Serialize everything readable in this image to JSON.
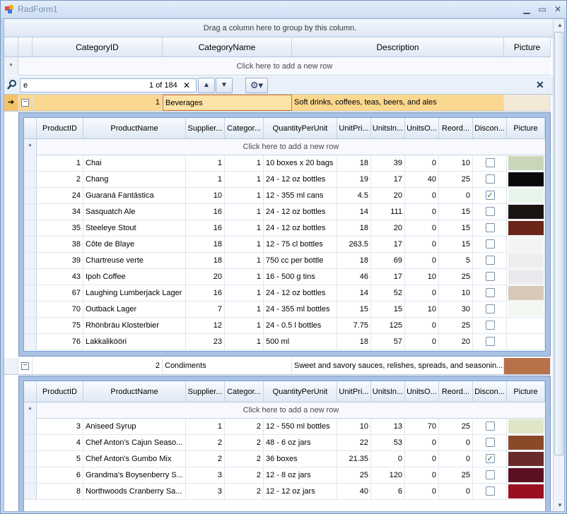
{
  "window": {
    "title": "RadForm1",
    "minimize": "▁",
    "maximize": "▭",
    "close": "✕"
  },
  "group_panel": {
    "text": "Drag a column here to group by this column."
  },
  "master_columns": [
    "CategoryID",
    "CategoryName",
    "Description",
    "Picture"
  ],
  "new_row_text": "Click here to add a new row",
  "new_row_marker": "*",
  "search": {
    "value": "e",
    "counter": "1 of 184",
    "clear": "✕",
    "close": "✕"
  },
  "master_rows": [
    {
      "id": "1",
      "name": "Beverages",
      "description": "Soft drinks, coffees, teas, beers, and ales",
      "pictureColor": "#f3e9d6"
    },
    {
      "id": "2",
      "name": "Condiments",
      "description": "Sweet and savory sauces, relishes, spreads, and seasonin...",
      "pictureColor": "#b9714a"
    }
  ],
  "child_columns": [
    "ProductID",
    "ProductName",
    "Supplier...",
    "Categor...",
    "QuantityPerUnit",
    "UnitPri...",
    "UnitsIn...",
    "UnitsO...",
    "Reord...",
    "Discon...",
    "Picture"
  ],
  "child_rows_1": [
    {
      "id": "1",
      "name": "Chai",
      "sup": "1",
      "cat": "1",
      "qty": "10 boxes x 20 bags",
      "price": "18",
      "stock": "39",
      "order": "0",
      "reorder": "10",
      "disc": false,
      "pic": "#c9d6b8"
    },
    {
      "id": "2",
      "name": "Chang",
      "sup": "1",
      "cat": "1",
      "qty": "24 - 12 oz bottles",
      "price": "19",
      "stock": "17",
      "order": "40",
      "reorder": "25",
      "disc": false,
      "pic": "#0a0a0a"
    },
    {
      "id": "24",
      "name": "Guaraná Fantástica",
      "sup": "10",
      "cat": "1",
      "qty": "12 - 355 ml cans",
      "price": "4.5",
      "stock": "20",
      "order": "0",
      "reorder": "0",
      "disc": true,
      "pic": "#e8f5ea"
    },
    {
      "id": "34",
      "name": "Sasquatch Ale",
      "sup": "16",
      "cat": "1",
      "qty": "24 - 12 oz bottles",
      "price": "14",
      "stock": "111",
      "order": "0",
      "reorder": "15",
      "disc": false,
      "pic": "#1a1512"
    },
    {
      "id": "35",
      "name": "Steeleye Stout",
      "sup": "16",
      "cat": "1",
      "qty": "24 - 12 oz bottles",
      "price": "18",
      "stock": "20",
      "order": "0",
      "reorder": "15",
      "disc": false,
      "pic": "#6a2418"
    },
    {
      "id": "38",
      "name": "Côte de Blaye",
      "sup": "18",
      "cat": "1",
      "qty": "12 - 75 cl bottles",
      "price": "263.5",
      "stock": "17",
      "order": "0",
      "reorder": "15",
      "disc": false,
      "pic": "#f4f4f4"
    },
    {
      "id": "39",
      "name": "Chartreuse verte",
      "sup": "18",
      "cat": "1",
      "qty": "750 cc per bottle",
      "price": "18",
      "stock": "69",
      "order": "0",
      "reorder": "5",
      "disc": false,
      "pic": "#eeeeee"
    },
    {
      "id": "43",
      "name": "Ipoh Coffee",
      "sup": "20",
      "cat": "1",
      "qty": "16 - 500 g tins",
      "price": "46",
      "stock": "17",
      "order": "10",
      "reorder": "25",
      "disc": false,
      "pic": "#e9e9ee"
    },
    {
      "id": "67",
      "name": "Laughing Lumberjack Lager",
      "sup": "16",
      "cat": "1",
      "qty": "24 - 12 oz bottles",
      "price": "14",
      "stock": "52",
      "order": "0",
      "reorder": "10",
      "disc": false,
      "pic": "#d8c8b8"
    },
    {
      "id": "70",
      "name": "Outback Lager",
      "sup": "7",
      "cat": "1",
      "qty": "24 - 355 ml bottles",
      "price": "15",
      "stock": "15",
      "order": "10",
      "reorder": "30",
      "disc": false,
      "pic": "#f2f7f2"
    },
    {
      "id": "75",
      "name": "Rhönbräu Klosterbier",
      "sup": "12",
      "cat": "1",
      "qty": "24 - 0.5 l bottles",
      "price": "7.75",
      "stock": "125",
      "order": "0",
      "reorder": "25",
      "disc": false,
      "pic": "#ffffff"
    },
    {
      "id": "76",
      "name": "Lakkalikööri",
      "sup": "23",
      "cat": "1",
      "qty": "500 ml",
      "price": "18",
      "stock": "57",
      "order": "0",
      "reorder": "20",
      "disc": false,
      "pic": "#ffffff"
    }
  ],
  "child_rows_2": [
    {
      "id": "3",
      "name": "Aniseed Syrup",
      "sup": "1",
      "cat": "2",
      "qty": "12 - 550 ml bottles",
      "price": "10",
      "stock": "13",
      "order": "70",
      "reorder": "25",
      "disc": false,
      "pic": "#dfe6c7"
    },
    {
      "id": "4",
      "name": "Chef Anton's Cajun Seaso...",
      "sup": "2",
      "cat": "2",
      "qty": "48 - 6 oz jars",
      "price": "22",
      "stock": "53",
      "order": "0",
      "reorder": "0",
      "disc": false,
      "pic": "#8a4a2a"
    },
    {
      "id": "5",
      "name": "Chef Anton's Gumbo Mix",
      "sup": "2",
      "cat": "2",
      "qty": "36 boxes",
      "price": "21.35",
      "stock": "0",
      "order": "0",
      "reorder": "0",
      "disc": true,
      "pic": "#6b2a2a"
    },
    {
      "id": "6",
      "name": "Grandma's Boysenberry S...",
      "sup": "3",
      "cat": "2",
      "qty": "12 - 8 oz jars",
      "price": "25",
      "stock": "120",
      "order": "0",
      "reorder": "25",
      "disc": false,
      "pic": "#5a1020"
    },
    {
      "id": "8",
      "name": "Northwoods Cranberry Sa...",
      "sup": "3",
      "cat": "2",
      "qty": "12 - 12 oz jars",
      "price": "40",
      "stock": "6",
      "order": "0",
      "reorder": "0",
      "disc": false,
      "pic": "#9a1020"
    }
  ],
  "colors": {
    "selected_row": "#fbd88f",
    "highlight": "#ffff7a",
    "accent": "#7aa0d8"
  }
}
